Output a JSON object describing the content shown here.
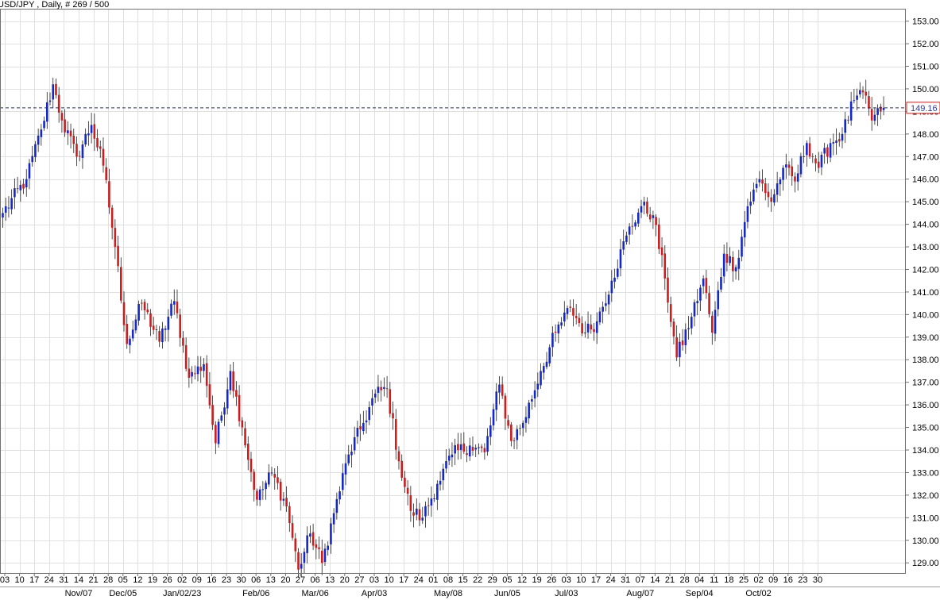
{
  "chart_data": {
    "type": "candlestick",
    "title": "USD/JPY , Daily, # 269 / 500",
    "colors": {
      "up": "#1428c8",
      "down": "#c81e1e",
      "grid": "#e0e0e0",
      "price_line": "#1a2a80",
      "background": "#ffffff"
    },
    "ylim": [
      128.55,
      153.55
    ],
    "yticks": [
      129,
      130,
      131,
      132,
      133,
      134,
      135,
      136,
      137,
      138,
      139,
      140,
      141,
      142,
      143,
      144,
      145,
      146,
      147,
      148,
      149,
      150,
      151,
      152,
      153
    ],
    "ytick_labels": [
      "129.00",
      "130.00",
      "131.00",
      "132.00",
      "133.00",
      "134.00",
      "135.00",
      "136.00",
      "137.00",
      "138.00",
      "139.00",
      "140.00",
      "141.00",
      "142.00",
      "143.00",
      "144.00",
      "145.00",
      "146.00",
      "147.00",
      "148.00",
      "149.00",
      "150.00",
      "151.00",
      "152.00",
      "153.00"
    ],
    "current_price": 149.16,
    "current_price_label": "149.16",
    "xtick_labels": [
      "03",
      "10",
      "17",
      "24",
      "31",
      "14",
      "21",
      "28",
      "05",
      "12",
      "19",
      "26",
      "02",
      "09",
      "16",
      "23",
      "30",
      "06",
      "13",
      "20",
      "27",
      "06",
      "13",
      "20",
      "27",
      "03",
      "10",
      "17",
      "24",
      "01",
      "08",
      "15",
      "22",
      "29",
      "05",
      "12",
      "19",
      "26",
      "03",
      "10",
      "17",
      "24",
      "31",
      "07",
      "14",
      "21",
      "28",
      "04",
      "11",
      "18",
      "25",
      "02",
      "09",
      "16",
      "23",
      "30"
    ],
    "month_labels": [
      {
        "label": "Nov/07",
        "at": 5
      },
      {
        "label": "Dec/05",
        "at": 8
      },
      {
        "label": "Jan/02/23",
        "at": 12
      },
      {
        "label": "Feb/06",
        "at": 17
      },
      {
        "label": "Mar/06",
        "at": 21
      },
      {
        "label": "Apr/03",
        "at": 25
      },
      {
        "label": "May/08",
        "at": 30
      },
      {
        "label": "Jun/05",
        "at": 34
      },
      {
        "label": "Jul/03",
        "at": 38
      },
      {
        "label": "Aug/07",
        "at": 43
      },
      {
        "label": "Sep/04",
        "at": 47
      },
      {
        "label": "Oct/02",
        "at": 51
      }
    ],
    "anchors": [
      [
        0,
        144.5,
        1
      ],
      [
        8,
        146.0,
        1
      ],
      [
        13,
        148.2,
        0
      ],
      [
        17,
        150.2,
        0
      ],
      [
        20,
        148.6,
        1
      ],
      [
        25,
        147.0,
        1
      ],
      [
        30,
        148.4,
        1
      ],
      [
        34,
        146.6,
        1
      ],
      [
        38,
        143.0,
        1
      ],
      [
        42,
        138.7,
        1
      ],
      [
        47,
        140.5,
        1
      ],
      [
        53,
        138.8,
        1
      ],
      [
        58,
        140.6,
        1
      ],
      [
        63,
        137.2,
        1
      ],
      [
        68,
        137.8,
        1
      ],
      [
        72,
        134.3,
        1
      ],
      [
        77,
        137.5,
        1
      ],
      [
        81,
        135.0,
        1
      ],
      [
        86,
        131.8,
        1
      ],
      [
        91,
        133.0,
        1
      ],
      [
        96,
        131.5,
        1
      ],
      [
        100,
        128.7,
        1
      ],
      [
        104,
        130.3,
        1
      ],
      [
        108,
        129.0,
        1
      ],
      [
        112,
        131.2,
        1
      ],
      [
        117,
        133.8,
        1
      ],
      [
        122,
        135.2,
        1
      ],
      [
        126,
        136.5,
        1
      ],
      [
        130,
        136.7,
        1
      ],
      [
        134,
        133.5,
        1
      ],
      [
        138,
        131.3,
        1
      ],
      [
        142,
        131.0,
        1
      ],
      [
        147,
        132.5,
        1
      ],
      [
        152,
        133.8,
        1
      ],
      [
        158,
        134.2,
        1
      ],
      [
        163,
        133.9,
        1
      ],
      [
        168,
        136.9,
        1
      ],
      [
        172,
        134.4,
        1
      ],
      [
        176,
        135.2,
        1
      ],
      [
        182,
        137.5,
        1
      ],
      [
        187,
        139.2,
        1
      ],
      [
        192,
        140.3,
        1
      ],
      [
        197,
        139.2,
        1
      ],
      [
        201,
        139.7,
        1
      ],
      [
        206,
        141.5,
        1
      ],
      [
        211,
        143.5,
        1
      ],
      [
        216,
        144.8,
        1
      ],
      [
        220,
        144.4,
        1
      ],
      [
        224,
        141.6,
        1
      ],
      [
        228,
        138.1,
        1
      ],
      [
        233,
        139.9,
        1
      ],
      [
        237,
        141.6,
        1
      ],
      [
        240,
        139.2,
        1
      ],
      [
        244,
        142.7,
        1
      ],
      [
        248,
        142.1,
        1
      ],
      [
        252,
        144.8,
        1
      ],
      [
        256,
        146.0,
        1
      ],
      [
        260,
        145.0,
        1
      ],
      [
        264,
        146.5,
        1
      ],
      [
        268,
        145.9,
        1
      ],
      [
        272,
        147.6,
        1
      ],
      [
        276,
        146.5,
        1
      ],
      [
        280,
        147.6,
        1
      ],
      [
        284,
        148.0,
        1
      ],
      [
        288,
        149.5,
        1
      ],
      [
        292,
        149.7,
        1
      ],
      [
        294,
        148.6,
        1
      ],
      [
        297,
        149.0,
        1
      ],
      [
        298,
        149.16,
        1
      ]
    ]
  }
}
